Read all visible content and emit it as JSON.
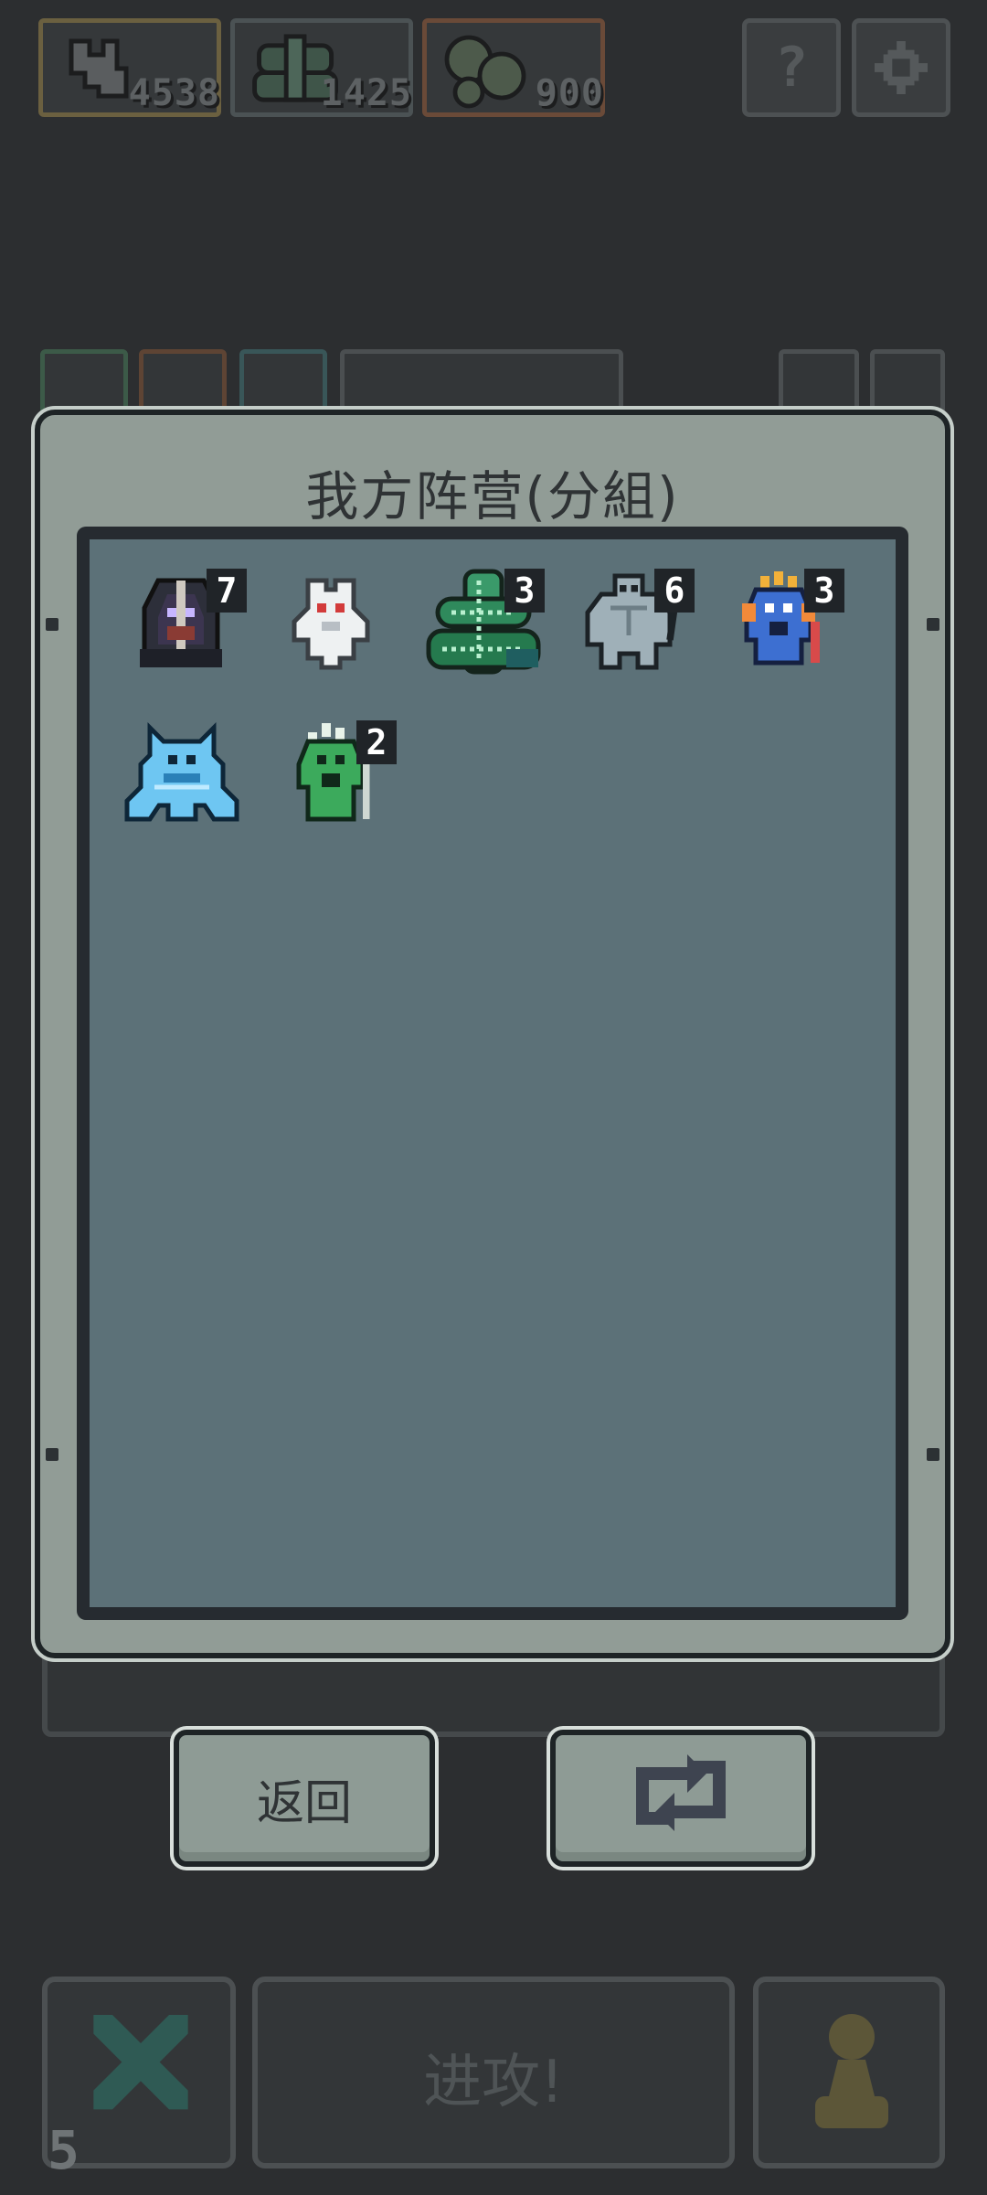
{
  "resources": [
    {
      "icon": "bones-icon",
      "value": "4538",
      "border": "#6b6040"
    },
    {
      "icon": "cactus-icon",
      "value": "1425",
      "border": "#4b5254"
    },
    {
      "icon": "slime-blob-icon",
      "value": "900",
      "border": "#6a4a38"
    }
  ],
  "header_buttons": {
    "help_label": "?",
    "settings_icon": "gear-icon"
  },
  "modal": {
    "title": "我方阵营(分組)",
    "units": [
      {
        "name": "hooded-knight",
        "count": "7"
      },
      {
        "name": "white-ghost",
        "count": ""
      },
      {
        "name": "green-cactus-snake",
        "count": "3"
      },
      {
        "name": "stone-golem",
        "count": "6"
      },
      {
        "name": "blue-fish-warrior",
        "count": "3"
      },
      {
        "name": "ice-demon",
        "count": ""
      },
      {
        "name": "green-lizard-shaman",
        "count": "2"
      }
    ]
  },
  "actions": {
    "back_label": "返回",
    "swap_icon": "swap-arrows-icon"
  },
  "bottom": {
    "cancel_icon": "x-icon",
    "attack_label": "进攻!",
    "pawn_icon": "pawn-icon",
    "level": "5"
  },
  "colors": {
    "background": "#2c2e30",
    "modal_frame": "#919c96",
    "modal_inner": "#5c7178",
    "text_dark": "#2f3335"
  }
}
